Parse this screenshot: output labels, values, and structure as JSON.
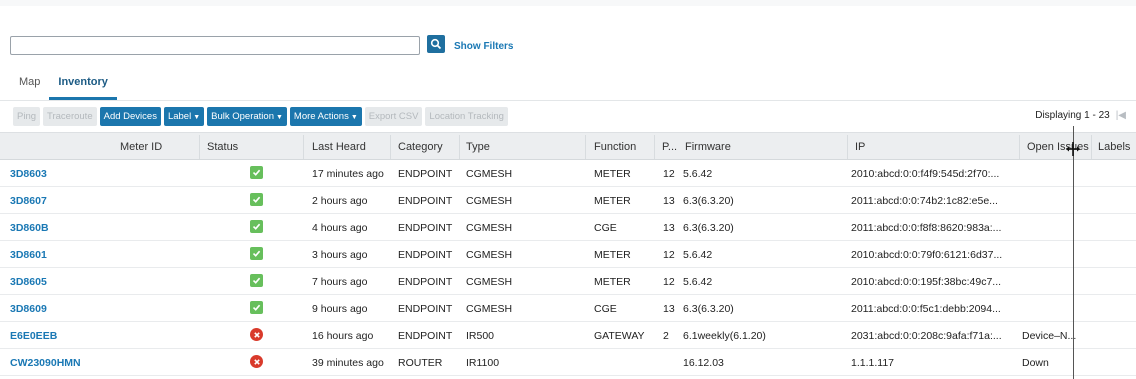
{
  "search": {
    "value": "",
    "placeholder": "",
    "show_filters_label": "Show Filters"
  },
  "tabs": [
    {
      "label": "Map",
      "active": false
    },
    {
      "label": "Inventory",
      "active": true
    }
  ],
  "toolbar": {
    "ping": "Ping",
    "traceroute": "Traceroute",
    "add_devices": "Add Devices",
    "label": "Label",
    "bulk_operation": "Bulk Operation",
    "more_actions": "More Actions",
    "export_csv": "Export CSV",
    "location_tracking": "Location Tracking"
  },
  "pagination": {
    "displaying": "Displaying 1 - 23"
  },
  "columns": {
    "meter_id": "Meter ID",
    "status": "Status",
    "last_heard": "Last Heard",
    "category": "Category",
    "type": "Type",
    "function": "Function",
    "p": "P...",
    "firmware": "Firmware",
    "ip": "IP",
    "open_issues": "Open Issues",
    "labels": "Labels"
  },
  "rows": [
    {
      "name": "3D8603",
      "status": "ok",
      "last_heard": "17 minutes ago",
      "category": "ENDPOINT",
      "type": "CGMESH",
      "function": "METER",
      "p": "12",
      "firmware": "5.6.42",
      "ip": "2010:abcd:0:0:f4f9:545d:2f70:...",
      "open_issues": ""
    },
    {
      "name": "3D8607",
      "status": "ok",
      "last_heard": "2 hours ago",
      "category": "ENDPOINT",
      "type": "CGMESH",
      "function": "METER",
      "p": "13",
      "firmware": "6.3(6.3.20)",
      "ip": "2011:abcd:0:0:74b2:1c82:e5e...",
      "open_issues": ""
    },
    {
      "name": "3D860B",
      "status": "ok",
      "last_heard": "4 hours ago",
      "category": "ENDPOINT",
      "type": "CGMESH",
      "function": "CGE",
      "p": "13",
      "firmware": "6.3(6.3.20)",
      "ip": "2011:abcd:0:0:f8f8:8620:983a:...",
      "open_issues": ""
    },
    {
      "name": "3D8601",
      "status": "ok",
      "last_heard": "3 hours ago",
      "category": "ENDPOINT",
      "type": "CGMESH",
      "function": "METER",
      "p": "12",
      "firmware": "5.6.42",
      "ip": "2010:abcd:0:0:79f0:6121:6d37...",
      "open_issues": ""
    },
    {
      "name": "3D8605",
      "status": "ok",
      "last_heard": "7 hours ago",
      "category": "ENDPOINT",
      "type": "CGMESH",
      "function": "METER",
      "p": "12",
      "firmware": "5.6.42",
      "ip": "2010:abcd:0:0:195f:38bc:49c7...",
      "open_issues": ""
    },
    {
      "name": "3D8609",
      "status": "ok",
      "last_heard": "9 hours ago",
      "category": "ENDPOINT",
      "type": "CGMESH",
      "function": "CGE",
      "p": "13",
      "firmware": "6.3(6.3.20)",
      "ip": "2011:abcd:0:0:f5c1:debb:2094...",
      "open_issues": ""
    },
    {
      "name": "E6E0EEB",
      "status": "error",
      "last_heard": "16 hours ago",
      "category": "ENDPOINT",
      "type": "IR500",
      "function": "GATEWAY",
      "p": "2",
      "firmware": "6.1weekly(6.1.20)",
      "ip": "2031:abcd:0:0:208c:9afa:f71a:...",
      "open_issues": "Device–N..."
    },
    {
      "name": "CW23090HMN",
      "status": "error",
      "last_heard": "39 minutes ago",
      "category": "ROUTER",
      "type": "IR1100",
      "function": "",
      "p": "",
      "firmware": "16.12.03",
      "ip": "1.1.1.117",
      "open_issues": "Down"
    }
  ],
  "colors": {
    "accent": "#1b76ad",
    "link": "#1a78b4",
    "ok": "#67bf5c",
    "error": "#d93a2b"
  }
}
